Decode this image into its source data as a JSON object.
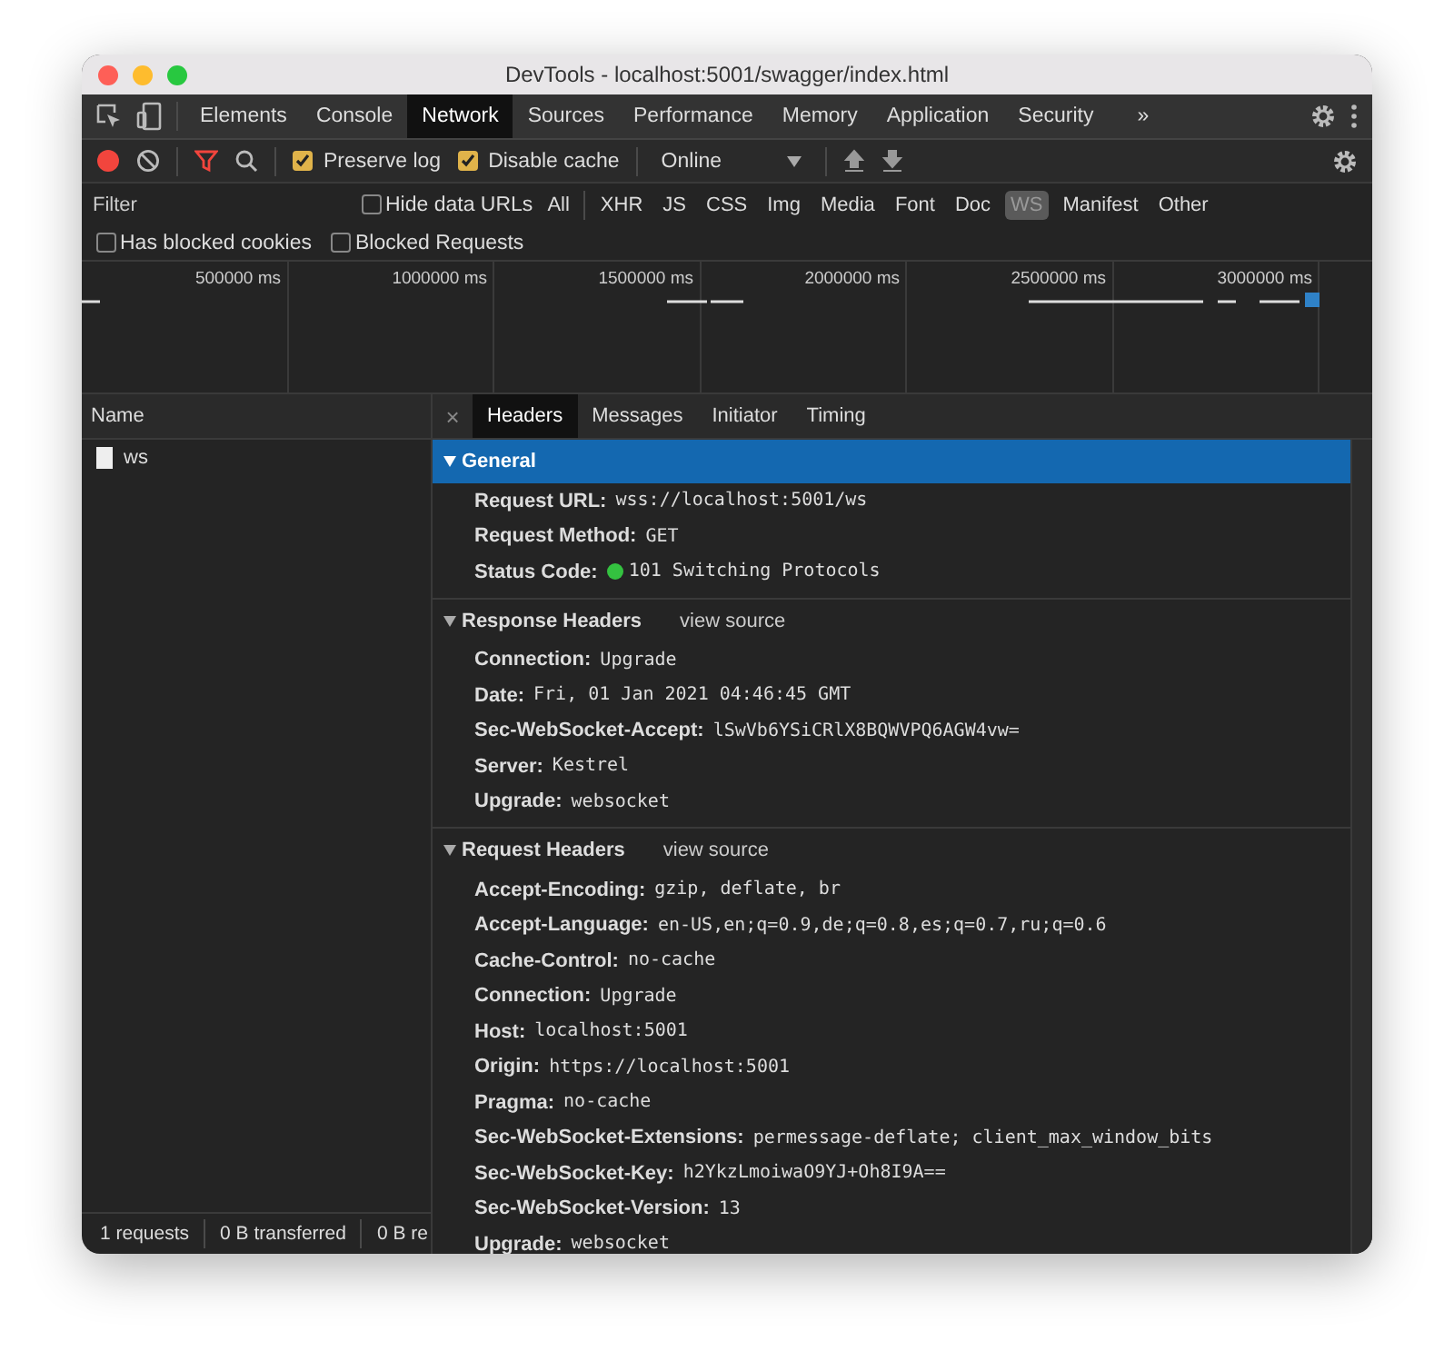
{
  "window": {
    "title": "DevTools - localhost:5001/swagger/index.html"
  },
  "panel_tabs": [
    {
      "label": "Elements",
      "selected": false
    },
    {
      "label": "Console",
      "selected": false
    },
    {
      "label": "Network",
      "selected": true
    },
    {
      "label": "Sources",
      "selected": false
    },
    {
      "label": "Performance",
      "selected": false
    },
    {
      "label": "Memory",
      "selected": false
    },
    {
      "label": "Application",
      "selected": false
    },
    {
      "label": "Security",
      "selected": false
    }
  ],
  "more_tabs": "»",
  "toolbar": {
    "recording": true,
    "preserve_log": {
      "label": "Preserve log",
      "checked": true
    },
    "disable_cache": {
      "label": "Disable cache",
      "checked": true
    },
    "throttling": "Online"
  },
  "filter": {
    "placeholder": "Filter",
    "hide_data_urls": {
      "label": "Hide data URLs",
      "checked": false
    },
    "types": [
      {
        "label": "All",
        "selected": false
      },
      {
        "label": "XHR",
        "selected": false
      },
      {
        "label": "JS",
        "selected": false
      },
      {
        "label": "CSS",
        "selected": false
      },
      {
        "label": "Img",
        "selected": false
      },
      {
        "label": "Media",
        "selected": false
      },
      {
        "label": "Font",
        "selected": false
      },
      {
        "label": "Doc",
        "selected": false
      },
      {
        "label": "WS",
        "selected": true
      },
      {
        "label": "Manifest",
        "selected": false
      },
      {
        "label": "Other",
        "selected": false
      }
    ],
    "options": [
      {
        "label": "Has blocked cookies",
        "checked": false
      },
      {
        "label": "Blocked Requests",
        "checked": false
      }
    ]
  },
  "timeline": {
    "ticks": [
      "500000 ms",
      "1000000 ms",
      "1500000 ms",
      "2000000 ms",
      "2500000 ms",
      "3000000 ms"
    ]
  },
  "requests": {
    "column": "Name",
    "rows": [
      {
        "name": "ws",
        "selected": false
      }
    ]
  },
  "detail": {
    "close": "×",
    "tabs": [
      {
        "label": "Headers",
        "selected": true
      },
      {
        "label": "Messages",
        "selected": false
      },
      {
        "label": "Initiator",
        "selected": false
      },
      {
        "label": "Timing",
        "selected": false
      }
    ],
    "sections": [
      {
        "title": "General",
        "expanded": true,
        "selected": true,
        "headers": [
          {
            "name": "Request URL:",
            "value": "wss://localhost:5001/ws"
          },
          {
            "name": "Request Method:",
            "value": "GET"
          },
          {
            "name": "Status Code:",
            "value": "101 Switching Protocols",
            "color": "#34c240"
          }
        ]
      },
      {
        "title": "Response Headers",
        "link": "view source",
        "expanded": true,
        "selected": false,
        "headers": [
          {
            "name": "Connection:",
            "value": "Upgrade"
          },
          {
            "name": "Date:",
            "value": "Fri, 01 Jan 2021 04:46:45 GMT"
          },
          {
            "name": "Sec-WebSocket-Accept:",
            "value": "lSwVb6YSiCRlX8BQWVPQ6AGW4vw="
          },
          {
            "name": "Server:",
            "value": "Kestrel"
          },
          {
            "name": "Upgrade:",
            "value": "websocket"
          }
        ]
      },
      {
        "title": "Request Headers",
        "link": "view source",
        "expanded": true,
        "selected": false,
        "headers": [
          {
            "name": "Accept-Encoding:",
            "value": "gzip, deflate, br"
          },
          {
            "name": "Accept-Language:",
            "value": "en-US,en;q=0.9,de;q=0.8,es;q=0.7,ru;q=0.6"
          },
          {
            "name": "Cache-Control:",
            "value": "no-cache"
          },
          {
            "name": "Connection:",
            "value": "Upgrade"
          },
          {
            "name": "Host:",
            "value": "localhost:5001"
          },
          {
            "name": "Origin:",
            "value": "https://localhost:5001"
          },
          {
            "name": "Pragma:",
            "value": "no-cache"
          },
          {
            "name": "Sec-WebSocket-Extensions:",
            "value": "permessage-deflate; client_max_window_bits"
          },
          {
            "name": "Sec-WebSocket-Key:",
            "value": "h2YkzLmoiwaO9YJ+Oh8I9A=="
          },
          {
            "name": "Sec-WebSocket-Version:",
            "value": "13"
          },
          {
            "name": "Upgrade:",
            "value": "websocket"
          }
        ]
      }
    ]
  },
  "status_bar": [
    "1 requests",
    "0 B transferred",
    "0 B re"
  ]
}
